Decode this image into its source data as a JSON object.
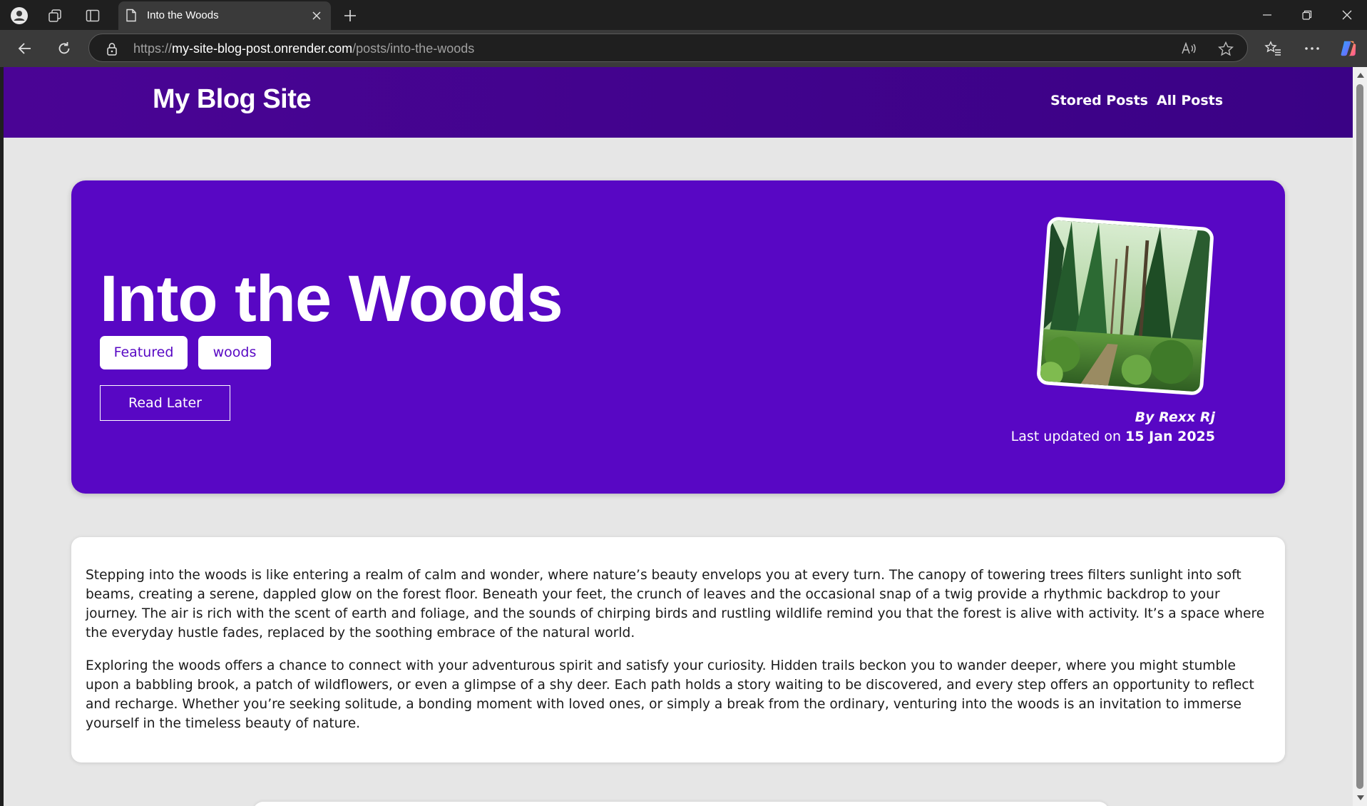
{
  "browser": {
    "tab_title": "Into the Woods",
    "url_scheme": "https://",
    "url_host": "my-site-blog-post.onrender.com",
    "url_path": "/posts/into-the-woods"
  },
  "site": {
    "title": "My Blog Site",
    "nav": [
      "Stored Posts",
      "All Posts"
    ]
  },
  "post": {
    "title": "Into the Woods",
    "tags": [
      "Featured",
      "woods"
    ],
    "read_later_label": "Read Later",
    "author": "By Rexx Rj",
    "updated_prefix": "Last updated on ",
    "updated_date": "15 Jan 2025",
    "image_icon": "forest-trail-photo",
    "paragraphs": [
      "Stepping into the woods is like entering a realm of calm and wonder, where nature’s beauty envelops you at every turn. The canopy of towering trees filters sunlight into soft beams, creating a serene, dappled glow on the forest floor. Beneath your feet, the crunch of leaves and the occasional snap of a twig provide a rhythmic backdrop to your journey. The air is rich with the scent of earth and foliage, and the sounds of chirping birds and rustling wildlife remind you that the forest is alive with activity. It’s a space where the everyday hustle fades, replaced by the soothing embrace of the natural world.",
      "Exploring the woods offers a chance to connect with your adventurous spirit and satisfy your curiosity. Hidden trails beckon you to wander deeper, where you might stumble upon a babbling brook, a patch of wildflowers, or even a glimpse of a shy deer. Each path holds a story waiting to be discovered, and every step offers an opportunity to reflect and recharge. Whether you’re seeking solitude, a bonding moment with loved ones, or simply a break from the ordinary, venturing into the woods is an invitation to immerse yourself in the timeless beauty of nature."
    ]
  },
  "colors": {
    "header_bg": "#4a0495",
    "hero_bg": "#5807c4",
    "page_bg": "#e6e6e6",
    "tag_text": "#5807c4"
  }
}
